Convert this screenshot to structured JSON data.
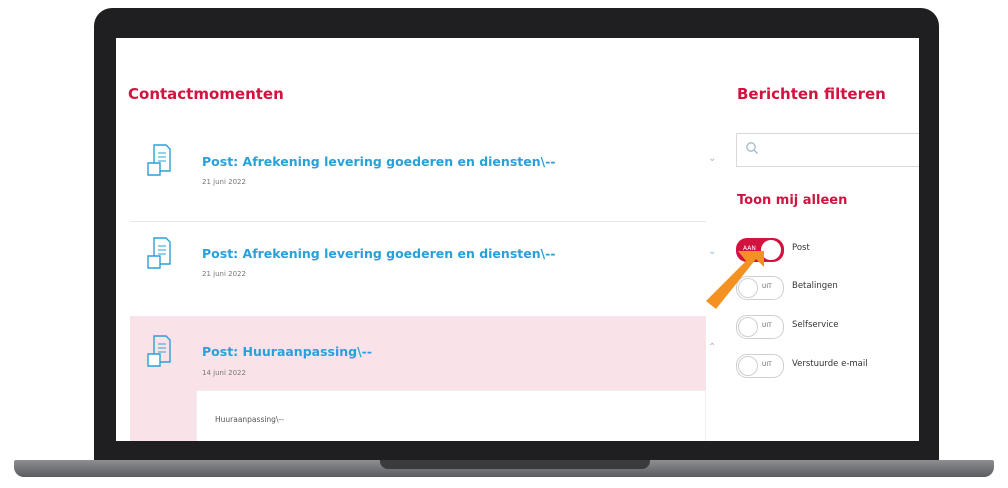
{
  "left": {
    "title": "Contactmomenten",
    "items": [
      {
        "title": "Post: Afrekening levering goederen en diensten\\--",
        "date": "21 juni 2022",
        "expanded": false
      },
      {
        "title": "Post: Afrekening levering goederen en diensten\\--",
        "date": "21 juni 2022",
        "expanded": false
      },
      {
        "title": "Post: Huuraanpassing\\--",
        "date": "14 juni 2022",
        "expanded": true,
        "body": "Huuraanpassing\\--"
      }
    ]
  },
  "right": {
    "title": "Berichten filteren",
    "search": {
      "placeholder": "",
      "icon": "search-icon"
    },
    "filter_heading": "Toon mij alleen",
    "toggles": [
      {
        "state_text": "AAN",
        "label": "Post",
        "on": true
      },
      {
        "state_text": "UIT",
        "label": "Betalingen",
        "on": false
      },
      {
        "state_text": "UIT",
        "label": "Selfservice",
        "on": false
      },
      {
        "state_text": "UIT",
        "label": "Verstuurde e-mail",
        "on": false
      }
    ]
  },
  "colors": {
    "accent": "#d2123f",
    "link": "#2aa0d8",
    "highlight_row": "#f9e3e8",
    "pointer_arrow": "#f39223"
  }
}
